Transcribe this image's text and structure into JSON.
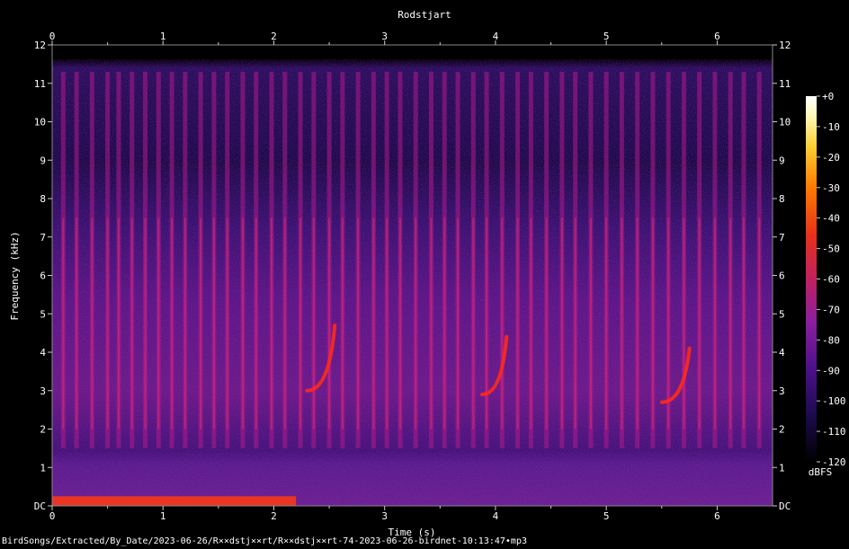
{
  "chart_data": {
    "type": "heatmap",
    "title": "Rodstjart",
    "xlabel": "Time (s)",
    "ylabel": "Frequency (kHz)",
    "xlim": [
      0,
      6.5
    ],
    "ylim": [
      0,
      12
    ],
    "x_ticks": [
      "0",
      "1",
      "2",
      "3",
      "4",
      "5",
      "6"
    ],
    "y_ticks": [
      "DC",
      "1",
      "2",
      "3",
      "4",
      "5",
      "6",
      "7",
      "8",
      "9",
      "10",
      "11",
      "12"
    ],
    "colorbar": {
      "label": "dBFS",
      "ticks": [
        "+0",
        "-10",
        "-20",
        "-30",
        "-40",
        "-50",
        "-60",
        "-70",
        "-80",
        "-90",
        "-100",
        "-110",
        "-120"
      ],
      "range": [
        -120,
        0
      ],
      "colors": [
        "#000000",
        "#1a0a4a",
        "#4a108a",
        "#8a1ea0",
        "#c02060",
        "#e8301a",
        "#ff7a00",
        "#ffcc30",
        "#fff6b0",
        "#ffffff"
      ]
    },
    "broadband_clicks_s": [
      0.1,
      0.22,
      0.36,
      0.5,
      0.6,
      0.72,
      0.84,
      0.96,
      1.08,
      1.2,
      1.34,
      1.46,
      1.58,
      1.72,
      1.84,
      1.98,
      2.1,
      2.24,
      2.36,
      2.5,
      2.62,
      2.76,
      2.9,
      3.02,
      3.14,
      3.28,
      3.42,
      3.54,
      3.66,
      3.8,
      3.92,
      4.06,
      4.2,
      4.32,
      4.46,
      4.6,
      4.72,
      4.86,
      5.0,
      5.14,
      5.28,
      5.42,
      5.56,
      5.7,
      5.84,
      5.98,
      6.12,
      6.24,
      6.38
    ],
    "song_strokes": [
      {
        "t_start": 2.3,
        "t_end": 2.55,
        "f_start_khz": 3.0,
        "f_end_khz": 4.7
      },
      {
        "t_start": 3.88,
        "t_end": 4.1,
        "f_start_khz": 2.9,
        "f_end_khz": 4.4
      },
      {
        "t_start": 5.5,
        "t_end": 5.75,
        "f_start_khz": 2.7,
        "f_end_khz": 4.1
      }
    ],
    "low_freq_noise_burst": {
      "t_start": 0.0,
      "t_end": 2.2,
      "f_khz": 0.1
    }
  },
  "footer_path": "BirdSongs/Extracted/By_Date/2023-06-26/R××dstj××rt/R××dstj××rt-74-2023-06-26-birdnet-10:13:47•mp3"
}
